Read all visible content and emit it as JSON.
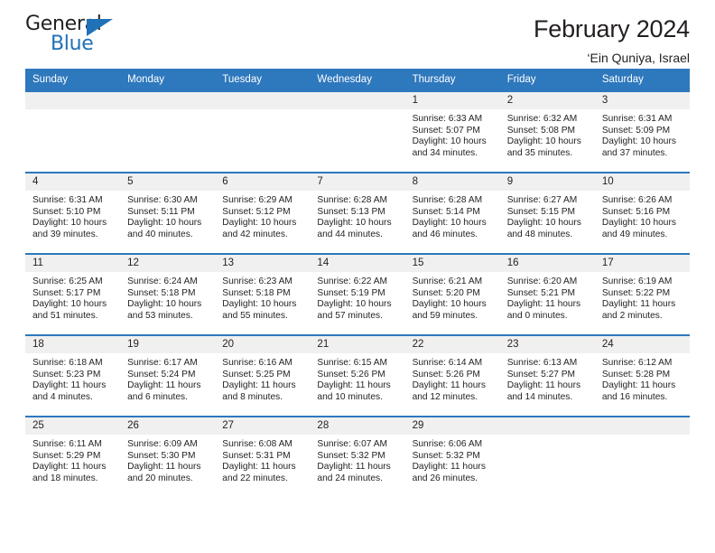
{
  "logo": {
    "primary_text": "General",
    "secondary_text": "Blue",
    "triangle_color": "#1f71b8"
  },
  "header": {
    "title": "February 2024",
    "subtitle": "‘Ein Quniya, Israel"
  },
  "theme": {
    "header_blue": "#2e78bd",
    "daynum_gray": "#f0f0f0",
    "text": "#231f20"
  },
  "weekday_headers": [
    "Sunday",
    "Monday",
    "Tuesday",
    "Wednesday",
    "Thursday",
    "Friday",
    "Saturday"
  ],
  "labels": {
    "sunrise": "Sunrise:",
    "sunset": "Sunset:",
    "daylight": "Daylight:"
  },
  "weeks": [
    [
      {
        "day": "",
        "sunrise": "",
        "sunset": "",
        "daylight": ""
      },
      {
        "day": "",
        "sunrise": "",
        "sunset": "",
        "daylight": ""
      },
      {
        "day": "",
        "sunrise": "",
        "sunset": "",
        "daylight": ""
      },
      {
        "day": "",
        "sunrise": "",
        "sunset": "",
        "daylight": ""
      },
      {
        "day": "1",
        "sunrise": "Sunrise: 6:33 AM",
        "sunset": "Sunset: 5:07 PM",
        "daylight": "Daylight: 10 hours and 34 minutes."
      },
      {
        "day": "2",
        "sunrise": "Sunrise: 6:32 AM",
        "sunset": "Sunset: 5:08 PM",
        "daylight": "Daylight: 10 hours and 35 minutes."
      },
      {
        "day": "3",
        "sunrise": "Sunrise: 6:31 AM",
        "sunset": "Sunset: 5:09 PM",
        "daylight": "Daylight: 10 hours and 37 minutes."
      }
    ],
    [
      {
        "day": "4",
        "sunrise": "Sunrise: 6:31 AM",
        "sunset": "Sunset: 5:10 PM",
        "daylight": "Daylight: 10 hours and 39 minutes."
      },
      {
        "day": "5",
        "sunrise": "Sunrise: 6:30 AM",
        "sunset": "Sunset: 5:11 PM",
        "daylight": "Daylight: 10 hours and 40 minutes."
      },
      {
        "day": "6",
        "sunrise": "Sunrise: 6:29 AM",
        "sunset": "Sunset: 5:12 PM",
        "daylight": "Daylight: 10 hours and 42 minutes."
      },
      {
        "day": "7",
        "sunrise": "Sunrise: 6:28 AM",
        "sunset": "Sunset: 5:13 PM",
        "daylight": "Daylight: 10 hours and 44 minutes."
      },
      {
        "day": "8",
        "sunrise": "Sunrise: 6:28 AM",
        "sunset": "Sunset: 5:14 PM",
        "daylight": "Daylight: 10 hours and 46 minutes."
      },
      {
        "day": "9",
        "sunrise": "Sunrise: 6:27 AM",
        "sunset": "Sunset: 5:15 PM",
        "daylight": "Daylight: 10 hours and 48 minutes."
      },
      {
        "day": "10",
        "sunrise": "Sunrise: 6:26 AM",
        "sunset": "Sunset: 5:16 PM",
        "daylight": "Daylight: 10 hours and 49 minutes."
      }
    ],
    [
      {
        "day": "11",
        "sunrise": "Sunrise: 6:25 AM",
        "sunset": "Sunset: 5:17 PM",
        "daylight": "Daylight: 10 hours and 51 minutes."
      },
      {
        "day": "12",
        "sunrise": "Sunrise: 6:24 AM",
        "sunset": "Sunset: 5:18 PM",
        "daylight": "Daylight: 10 hours and 53 minutes."
      },
      {
        "day": "13",
        "sunrise": "Sunrise: 6:23 AM",
        "sunset": "Sunset: 5:18 PM",
        "daylight": "Daylight: 10 hours and 55 minutes."
      },
      {
        "day": "14",
        "sunrise": "Sunrise: 6:22 AM",
        "sunset": "Sunset: 5:19 PM",
        "daylight": "Daylight: 10 hours and 57 minutes."
      },
      {
        "day": "15",
        "sunrise": "Sunrise: 6:21 AM",
        "sunset": "Sunset: 5:20 PM",
        "daylight": "Daylight: 10 hours and 59 minutes."
      },
      {
        "day": "16",
        "sunrise": "Sunrise: 6:20 AM",
        "sunset": "Sunset: 5:21 PM",
        "daylight": "Daylight: 11 hours and 0 minutes."
      },
      {
        "day": "17",
        "sunrise": "Sunrise: 6:19 AM",
        "sunset": "Sunset: 5:22 PM",
        "daylight": "Daylight: 11 hours and 2 minutes."
      }
    ],
    [
      {
        "day": "18",
        "sunrise": "Sunrise: 6:18 AM",
        "sunset": "Sunset: 5:23 PM",
        "daylight": "Daylight: 11 hours and 4 minutes."
      },
      {
        "day": "19",
        "sunrise": "Sunrise: 6:17 AM",
        "sunset": "Sunset: 5:24 PM",
        "daylight": "Daylight: 11 hours and 6 minutes."
      },
      {
        "day": "20",
        "sunrise": "Sunrise: 6:16 AM",
        "sunset": "Sunset: 5:25 PM",
        "daylight": "Daylight: 11 hours and 8 minutes."
      },
      {
        "day": "21",
        "sunrise": "Sunrise: 6:15 AM",
        "sunset": "Sunset: 5:26 PM",
        "daylight": "Daylight: 11 hours and 10 minutes."
      },
      {
        "day": "22",
        "sunrise": "Sunrise: 6:14 AM",
        "sunset": "Sunset: 5:26 PM",
        "daylight": "Daylight: 11 hours and 12 minutes."
      },
      {
        "day": "23",
        "sunrise": "Sunrise: 6:13 AM",
        "sunset": "Sunset: 5:27 PM",
        "daylight": "Daylight: 11 hours and 14 minutes."
      },
      {
        "day": "24",
        "sunrise": "Sunrise: 6:12 AM",
        "sunset": "Sunset: 5:28 PM",
        "daylight": "Daylight: 11 hours and 16 minutes."
      }
    ],
    [
      {
        "day": "25",
        "sunrise": "Sunrise: 6:11 AM",
        "sunset": "Sunset: 5:29 PM",
        "daylight": "Daylight: 11 hours and 18 minutes."
      },
      {
        "day": "26",
        "sunrise": "Sunrise: 6:09 AM",
        "sunset": "Sunset: 5:30 PM",
        "daylight": "Daylight: 11 hours and 20 minutes."
      },
      {
        "day": "27",
        "sunrise": "Sunrise: 6:08 AM",
        "sunset": "Sunset: 5:31 PM",
        "daylight": "Daylight: 11 hours and 22 minutes."
      },
      {
        "day": "28",
        "sunrise": "Sunrise: 6:07 AM",
        "sunset": "Sunset: 5:32 PM",
        "daylight": "Daylight: 11 hours and 24 minutes."
      },
      {
        "day": "29",
        "sunrise": "Sunrise: 6:06 AM",
        "sunset": "Sunset: 5:32 PM",
        "daylight": "Daylight: 11 hours and 26 minutes."
      },
      {
        "day": "",
        "sunrise": "",
        "sunset": "",
        "daylight": ""
      },
      {
        "day": "",
        "sunrise": "",
        "sunset": "",
        "daylight": ""
      }
    ]
  ]
}
